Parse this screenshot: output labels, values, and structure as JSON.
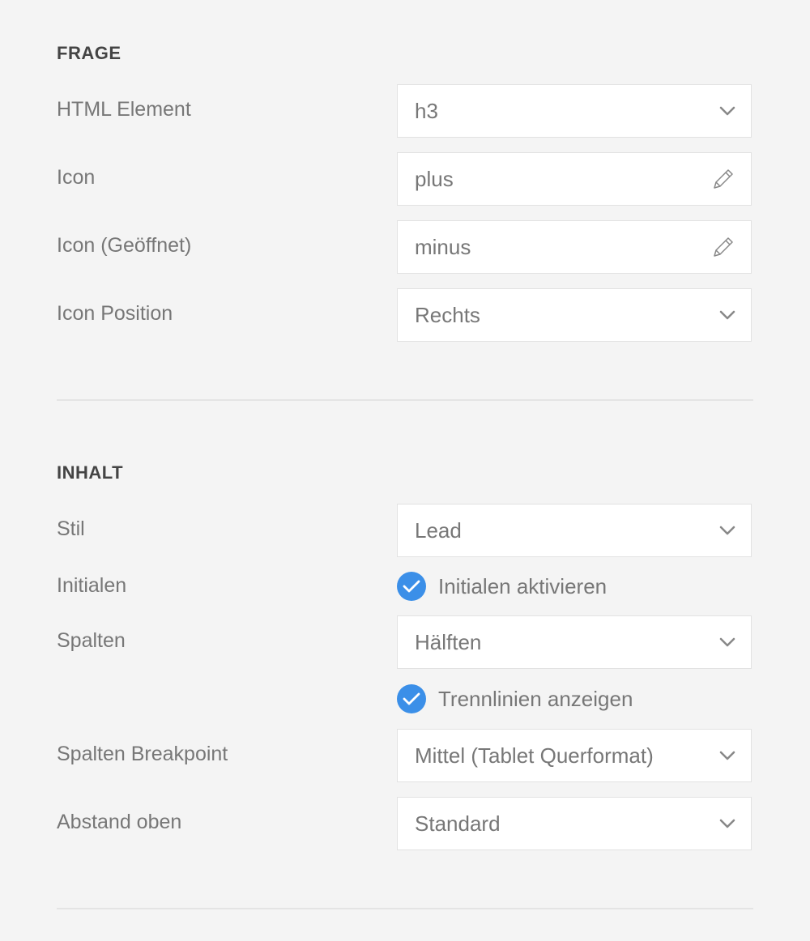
{
  "sections": {
    "frage": {
      "title": "FRAGE",
      "html_element": {
        "label": "HTML Element",
        "value": "h3"
      },
      "icon": {
        "label": "Icon",
        "value": "plus"
      },
      "icon_open": {
        "label": "Icon (Geöffnet)",
        "value": "minus"
      },
      "icon_position": {
        "label": "Icon Position",
        "value": "Rechts"
      }
    },
    "inhalt": {
      "title": "INHALT",
      "stil": {
        "label": "Stil",
        "value": "Lead"
      },
      "initialen": {
        "label": "Initialen",
        "checkbox_label": "Initialen aktivieren",
        "checked": true
      },
      "spalten": {
        "label": "Spalten",
        "value": "Hälften"
      },
      "trennlinien": {
        "checkbox_label": "Trennlinien anzeigen",
        "checked": true
      },
      "breakpoint": {
        "label": "Spalten Breakpoint",
        "value": "Mittel (Tablet Querformat)"
      },
      "abstand": {
        "label": "Abstand oben",
        "value": "Standard"
      }
    }
  },
  "colors": {
    "accent": "#3b8fe8",
    "background": "#f4f4f4",
    "field_border": "#e2e2e2"
  },
  "icons": {
    "dropdown": "chevron-down-icon",
    "edit": "pencil-icon",
    "check": "check-icon"
  }
}
